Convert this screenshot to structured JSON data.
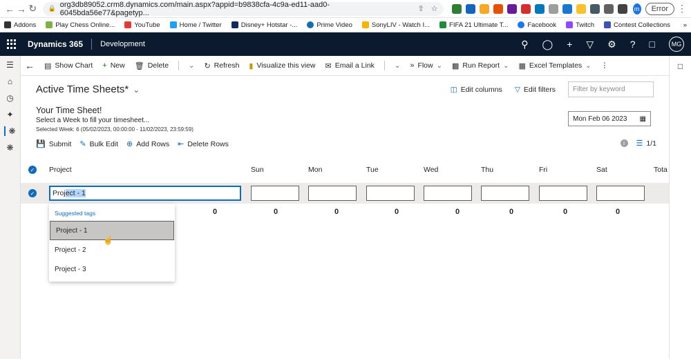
{
  "browser": {
    "url": "org3db89052.crm8.dynamics.com/main.aspx?appid=b9838cfa-4c9a-ed11-aad0-6045bda56e77&pagetyp...",
    "profile_initial": "m",
    "error_label": "Error",
    "bookmarks": [
      "Addons",
      "Play Chess Online...",
      "YouTube",
      "Home / Twitter",
      "Disney+ Hotstar -...",
      "Prime Video",
      "SonyLIV - Watch I...",
      "FIFA 21 Ultimate T...",
      "Facebook",
      "Twitch",
      "Contest Collections"
    ],
    "bookmarks_more": "»"
  },
  "app": {
    "title": "Dynamics 365",
    "environment": "Development",
    "avatar": "MG"
  },
  "commands": {
    "show_chart": "Show Chart",
    "new": "New",
    "delete": "Delete",
    "refresh": "Refresh",
    "visualize": "Visualize this view",
    "email_link": "Email a Link",
    "flow": "Flow",
    "run_report": "Run Report",
    "excel_templates": "Excel Templates"
  },
  "view": {
    "title": "Active Time Sheets*",
    "edit_columns": "Edit columns",
    "edit_filters": "Edit filters",
    "filter_placeholder": "Filter by keyword"
  },
  "timesheet": {
    "title": "Your Time Sheet!",
    "subtitle": "Select a Week to fill your timesheet...",
    "week": "Selected Week: 6 (05/02/2023, 00:00:00 - 11/02/2023, 23:59:59)",
    "date": "Mon Feb 06 2023",
    "actions": [
      "Submit",
      "Bulk Edit",
      "Add Rows",
      "Delete Rows"
    ],
    "pager": "1/1"
  },
  "grid": {
    "columns": [
      "Project",
      "Sun",
      "Mon",
      "Tue",
      "Wed",
      "Thu",
      "Fri",
      "Sat",
      "Tota"
    ],
    "row_value_prefix": "Proj",
    "row_value_selected": "ect - 1",
    "totals": [
      "0",
      "0",
      "0",
      "0",
      "0",
      "0",
      "0",
      "0"
    ]
  },
  "dropdown": {
    "header": "Suggested tags",
    "items": [
      "Project - 1",
      "Project - 2",
      "Project - 3"
    ]
  }
}
